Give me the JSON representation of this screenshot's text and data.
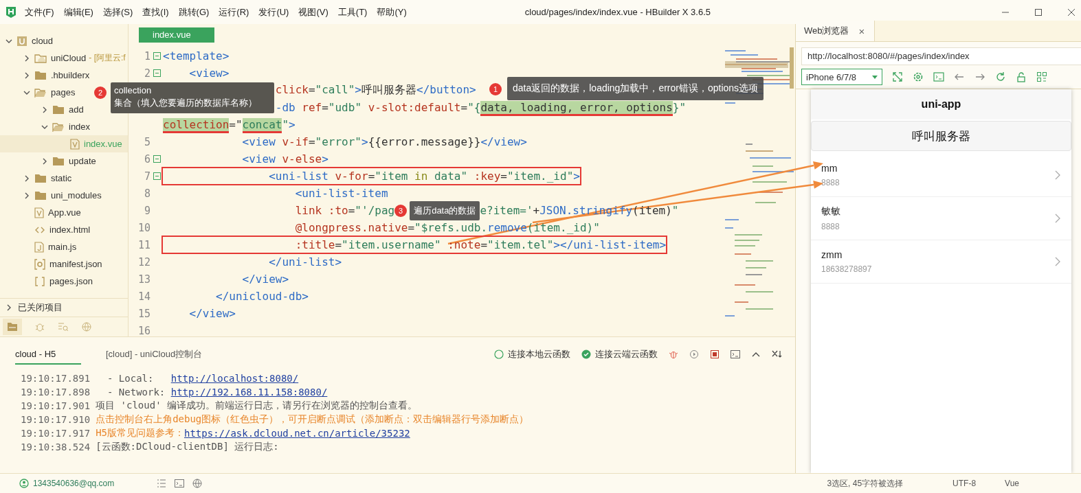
{
  "menu_bar": {
    "items": [
      "文件(F)",
      "编辑(E)",
      "选择(S)",
      "查找(I)",
      "跳转(G)",
      "运行(R)",
      "发行(U)",
      "视图(V)",
      "工具(T)",
      "帮助(Y)"
    ]
  },
  "window": {
    "title": "cloud/pages/index/index.vue - HBuilder X 3.6.5"
  },
  "sidebar": {
    "tree": [
      {
        "label": "cloud",
        "kind": "project",
        "expanded": true,
        "selected": false,
        "children": [
          {
            "label": "uniCloud",
            "suffix": "- [阿里云:f",
            "kind": "cloud-folder",
            "expanded": false,
            "selected": false
          },
          {
            "label": ".hbuilderx",
            "kind": "folder",
            "expanded": false,
            "selected": false
          },
          {
            "label": "pages",
            "kind": "folder",
            "expanded": true,
            "selected": false,
            "children": [
              {
                "label": "add",
                "kind": "folder",
                "expanded": false,
                "selected": false
              },
              {
                "label": "index",
                "kind": "folder",
                "expanded": true,
                "selected": false,
                "children": [
                  {
                    "label": "index.vue",
                    "kind": "vue",
                    "selected": true
                  }
                ]
              },
              {
                "label": "update",
                "kind": "folder",
                "expanded": false,
                "selected": false
              }
            ]
          },
          {
            "label": "static",
            "kind": "folder",
            "expanded": false,
            "selected": false
          },
          {
            "label": "uni_modules",
            "kind": "folder",
            "expanded": false,
            "selected": false
          },
          {
            "label": "App.vue",
            "kind": "vue",
            "selected": false
          },
          {
            "label": "index.html",
            "kind": "html",
            "selected": false
          },
          {
            "label": "main.js",
            "kind": "js",
            "selected": false
          },
          {
            "label": "manifest.json",
            "kind": "manifest",
            "selected": false
          },
          {
            "label": "pages.json",
            "kind": "json",
            "selected": false
          }
        ]
      }
    ],
    "closed_projects": "已关闭项目"
  },
  "editor": {
    "tab": "index.vue",
    "lines": [
      {
        "number": "1",
        "fold": true,
        "boxed": false,
        "tokens": [
          {
            "kind": "tag",
            "t": "<template>"
          }
        ]
      },
      {
        "number": "2",
        "fold": true,
        "boxed": false,
        "tokens": [
          {
            "kind": "tag",
            "t": "    <view>"
          }
        ]
      },
      {
        "fold": false,
        "boxed": false,
        "tokens": [
          {
            "kind": "attr",
            "t": "                 click"
          },
          {
            "kind": "text",
            "t": "="
          },
          {
            "kind": "str",
            "t": "\"call\""
          },
          {
            "kind": "tag",
            "t": ">"
          },
          {
            "kind": "text",
            "t": "呼叫服务器"
          },
          {
            "kind": "tag",
            "t": "</button>"
          }
        ]
      },
      {
        "fold": false,
        "boxed": false,
        "tokens": [
          {
            "kind": "tag",
            "t": "                 -db "
          },
          {
            "kind": "attr",
            "t": "ref"
          },
          {
            "kind": "text",
            "t": "="
          },
          {
            "kind": "str",
            "t": "\"udb\" "
          },
          {
            "kind": "attr",
            "t": "v-slot:default"
          },
          {
            "kind": "text",
            "t": "="
          },
          {
            "kind": "str",
            "t": "\"{"
          },
          {
            "kind": "mark-text",
            "t": "data, loading, error, options"
          },
          {
            "kind": "str",
            "t": "}\""
          }
        ]
      },
      {
        "fold": false,
        "boxed": false,
        "tokens": [
          {
            "kind": "mark-attr",
            "t": "collection"
          },
          {
            "kind": "text",
            "t": "=\""
          },
          {
            "kind": "mark-str",
            "t": "concat"
          },
          {
            "kind": "str",
            "t": "\""
          },
          {
            "kind": "tag",
            "t": ">"
          }
        ]
      },
      {
        "number": "5",
        "fold": false,
        "boxed": false,
        "tokens": [
          {
            "kind": "tag",
            "t": "            <view "
          },
          {
            "kind": "attr",
            "t": "v-if"
          },
          {
            "kind": "text",
            "t": "="
          },
          {
            "kind": "str",
            "t": "\"error\""
          },
          {
            "kind": "tag",
            "t": ">"
          },
          {
            "kind": "text",
            "t": "{{error.message}}"
          },
          {
            "kind": "tag",
            "t": "</view>"
          }
        ]
      },
      {
        "number": "6",
        "fold": true,
        "boxed": false,
        "tokens": [
          {
            "kind": "tag",
            "t": "            <view "
          },
          {
            "kind": "attr",
            "t": "v-else"
          },
          {
            "kind": "tag",
            "t": ">"
          }
        ]
      },
      {
        "number": "7",
        "fold": true,
        "boxed": true,
        "tokens": [
          {
            "kind": "tag",
            "t": "                <uni-list "
          },
          {
            "kind": "attr",
            "t": "v-for"
          },
          {
            "kind": "text",
            "t": "="
          },
          {
            "kind": "str",
            "t": "\"item "
          },
          {
            "kind": "kw",
            "t": "in"
          },
          {
            "kind": "str",
            "t": " data\" "
          },
          {
            "kind": "attr",
            "t": ":key"
          },
          {
            "kind": "text",
            "t": "="
          },
          {
            "kind": "str",
            "t": "\"item._id\""
          },
          {
            "kind": "tag",
            "t": ">"
          }
        ]
      },
      {
        "number": "8",
        "fold": false,
        "boxed": false,
        "tokens": [
          {
            "kind": "tag",
            "t": "                    <uni-list-item"
          }
        ]
      },
      {
        "number": "9",
        "fold": false,
        "boxed": false,
        "tokens": [
          {
            "kind": "attr",
            "t": "                    link :to"
          },
          {
            "kind": "text",
            "t": "="
          },
          {
            "kind": "str",
            "t": "\"'/pag"
          },
          {
            "kind": "callout",
            "number": "3",
            "t": "遍历data的数据"
          },
          {
            "kind": "str",
            "t": "e?item='"
          },
          {
            "kind": "text",
            "t": "+"
          },
          {
            "kind": "tag",
            "t": "JSON.stringify"
          },
          {
            "kind": "text",
            "t": "(item)"
          },
          {
            "kind": "str",
            "t": "\""
          }
        ]
      },
      {
        "number": "10",
        "fold": false,
        "boxed": false,
        "tokens": [
          {
            "kind": "attr",
            "t": "                    @longpress.native"
          },
          {
            "kind": "text",
            "t": "="
          },
          {
            "kind": "str",
            "t": "\"$refs.udb."
          },
          {
            "kind": "tag",
            "t": "remove"
          },
          {
            "kind": "str",
            "t": "(item._id)\""
          }
        ]
      },
      {
        "number": "11",
        "fold": false,
        "boxed": true,
        "tokens": [
          {
            "kind": "attr",
            "t": "                    :title"
          },
          {
            "kind": "text",
            "t": "="
          },
          {
            "kind": "str",
            "t": "\"item.username\" "
          },
          {
            "kind": "attr",
            "t": ":note"
          },
          {
            "kind": "text",
            "t": "="
          },
          {
            "kind": "str",
            "t": "\"item.tel\""
          },
          {
            "kind": "tag",
            "t": "></uni-list-item>"
          }
        ]
      },
      {
        "number": "12",
        "fold": false,
        "boxed": false,
        "tokens": [
          {
            "kind": "tag",
            "t": "                </uni-list>"
          }
        ]
      },
      {
        "number": "13",
        "fold": false,
        "boxed": false,
        "tokens": [
          {
            "kind": "tag",
            "t": "            </view>"
          }
        ]
      },
      {
        "number": "14",
        "fold": false,
        "boxed": false,
        "tokens": [
          {
            "kind": "tag",
            "t": "        </unicloud-db>"
          }
        ]
      },
      {
        "number": "15",
        "fold": false,
        "boxed": false,
        "tokens": [
          {
            "kind": "tag",
            "t": "    </view>"
          }
        ]
      },
      {
        "number": "16",
        "fold": false,
        "boxed": false
      }
    ]
  },
  "callouts": [
    {
      "number": "2",
      "lines": [
        "collection",
        "集合（填入您要遍历的数据库名称）"
      ]
    },
    {
      "number": "1",
      "lines": [
        "data返回的数据，loading加载中，error错误，options选项"
      ]
    }
  ],
  "browser": {
    "tab": "Web浏览器",
    "tab_close": "×",
    "url": "http://localhost:8080/#/pages/index/index",
    "device": "iPhone 6/7/8",
    "phone": {
      "title": "uni-app",
      "button": "呼叫服务器",
      "items": [
        {
          "title": "mm",
          "note": "8888"
        },
        {
          "title": "敏敏",
          "note": "8888"
        },
        {
          "title": "zmm",
          "note": "18638278897"
        }
      ]
    }
  },
  "console": {
    "tabs": [
      {
        "label": "cloud - H5",
        "selected": true
      },
      {
        "label": "[cloud] - uniCloud控制台",
        "selected": false
      }
    ],
    "options": [
      {
        "label": "连接本地云函数",
        "checked": false
      },
      {
        "label": "连接云端云函数",
        "checked": true
      }
    ],
    "lines": [
      {
        "time": "19:10:17.891",
        "segments": [
          {
            "kind": "text",
            "t": "  - Local:   "
          },
          {
            "kind": "link",
            "t": "http://localhost:8080/"
          }
        ]
      },
      {
        "time": "19:10:17.898",
        "segments": [
          {
            "kind": "text",
            "t": "  - Network: "
          },
          {
            "kind": "link",
            "t": "http://192.168.11.158:8080/"
          }
        ]
      },
      {
        "time": "19:10:17.901",
        "segments": [
          {
            "kind": "text",
            "t": "项目 'cloud' 编译成功。前端运行日志，请另行在浏览器的控制台查看。"
          }
        ]
      },
      {
        "time": "19:10:17.910",
        "segments": [
          {
            "kind": "warn",
            "t": "点击控制台右上角debug图标（红色虫子），可开启断点调试（添加断点：双击编辑器行号添加断点）"
          }
        ]
      },
      {
        "time": "19:10:17.917",
        "segments": [
          {
            "kind": "warn",
            "t": "H5版常见问题参考："
          },
          {
            "kind": "link",
            "t": "https://ask.dcloud.net.cn/article/35232"
          }
        ]
      },
      {
        "time": "19:10:38.524",
        "segments": [
          {
            "kind": "text",
            "t": "[云函数:DCloud-clientDB] 运行日志:"
          }
        ]
      }
    ]
  },
  "status_bar": {
    "user": "1343540636@qq.com",
    "selection": "3选区, 45字符被选择",
    "encoding": "UTF-8",
    "language": "Vue"
  }
}
